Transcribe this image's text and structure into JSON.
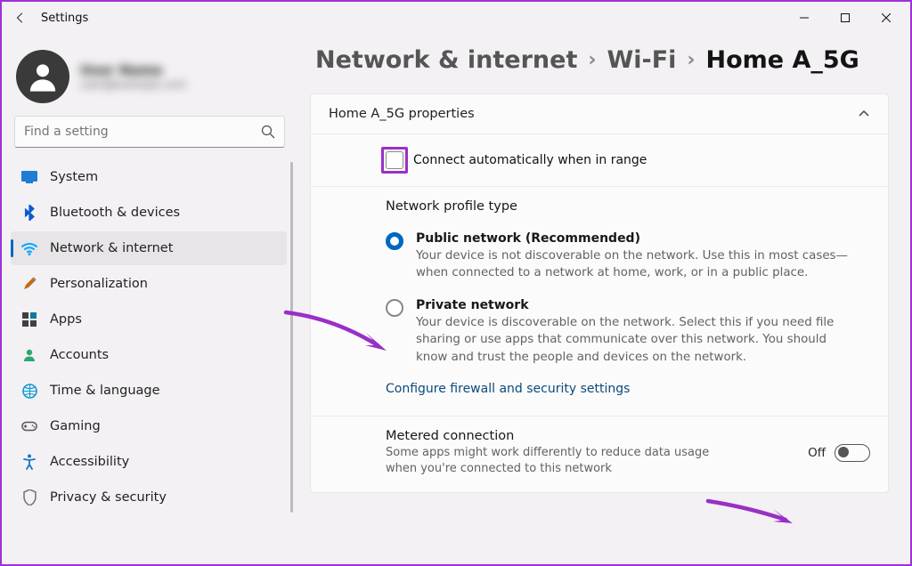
{
  "app_title": "Settings",
  "profile": {
    "name": "User Name",
    "email": "user@example.com"
  },
  "search": {
    "placeholder": "Find a setting"
  },
  "sidebar": {
    "items": [
      {
        "label": "System"
      },
      {
        "label": "Bluetooth & devices"
      },
      {
        "label": "Network & internet"
      },
      {
        "label": "Personalization"
      },
      {
        "label": "Apps"
      },
      {
        "label": "Accounts"
      },
      {
        "label": "Time & language"
      },
      {
        "label": "Gaming"
      },
      {
        "label": "Accessibility"
      },
      {
        "label": "Privacy & security"
      }
    ]
  },
  "breadcrumb": {
    "a": "Network & internet",
    "b": "Wi-Fi",
    "c": "Home A_5G"
  },
  "panel": {
    "title": "Home A_5G properties",
    "connect_label": "Connect automatically when in range",
    "profile_type_heading": "Network profile type",
    "public": {
      "title": "Public network (Recommended)",
      "desc": "Your device is not discoverable on the network. Use this in most cases—when connected to a network at home, work, or in a public place."
    },
    "private": {
      "title": "Private network",
      "desc": "Your device is discoverable on the network. Select this if you need file sharing or use apps that communicate over this network. You should know and trust the people and devices on the network."
    },
    "firewall_link": "Configure firewall and security settings",
    "metered": {
      "title": "Metered connection",
      "desc": "Some apps might work differently to reduce data usage when you're connected to this network",
      "state": "Off"
    }
  },
  "colors": {
    "accent": "#0067c0",
    "highlight": "#9a2fc8"
  }
}
